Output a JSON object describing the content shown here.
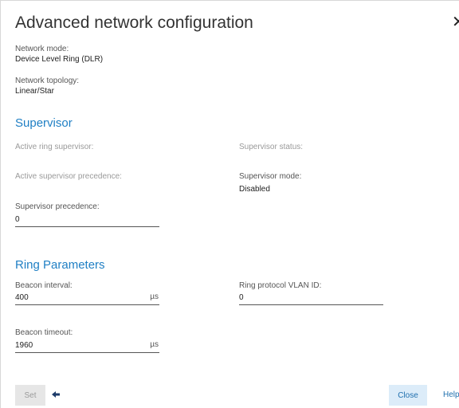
{
  "dialog": {
    "title": "Advanced network configuration",
    "close_glyph": "✕"
  },
  "network": {
    "mode_label": "Network mode:",
    "mode_value": "Device Level Ring (DLR)",
    "topology_label": "Network topology:",
    "topology_value": "Linear/Star"
  },
  "supervisor": {
    "heading": "Supervisor",
    "active_ring_supervisor_label": "Active ring supervisor:",
    "supervisor_status_label": "Supervisor status:",
    "active_supervisor_precedence_label": "Active supervisor precedence:",
    "supervisor_mode_label": "Supervisor mode:",
    "supervisor_mode_value": "Disabled",
    "precedence_label": "Supervisor precedence:",
    "precedence_value": "0"
  },
  "ring": {
    "heading": "Ring Parameters",
    "beacon_interval_label": "Beacon interval:",
    "beacon_interval_value": "400",
    "beacon_interval_unit": "µs",
    "vlan_label": "Ring protocol VLAN ID:",
    "vlan_value": "0",
    "beacon_timeout_label": "Beacon timeout:",
    "beacon_timeout_value": "1960",
    "beacon_timeout_unit": "µs"
  },
  "footer": {
    "set_label": "Set",
    "close_label": "Close",
    "help_label": "Help"
  },
  "colors": {
    "accent": "#1f7fc4",
    "close_button_bg": "#dcecf9",
    "set_button_bg": "#e6e6e6"
  },
  "icons": {
    "close": "close-icon",
    "back": "arrow-left-icon"
  }
}
